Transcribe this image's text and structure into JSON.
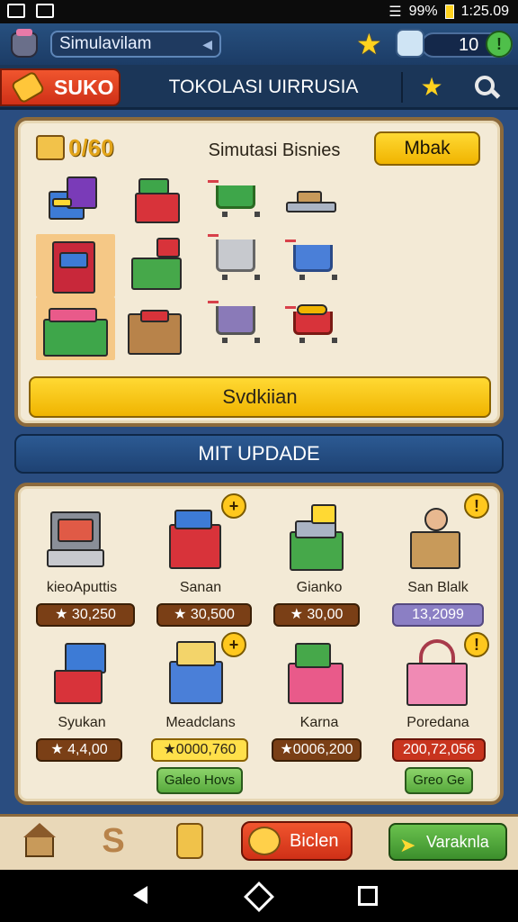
{
  "status_bar": {
    "battery": "99%",
    "time": "1:25.09"
  },
  "top_bar": {
    "username": "Simulavilam",
    "resource_count": "10",
    "plus_label": "!"
  },
  "nav": {
    "suko_label": "SUKO",
    "title": "TOKOLASI UIRRUSIA"
  },
  "shop_panel": {
    "coins": "0/60",
    "title": "Simutasi Bisnies",
    "mbak_label": "Mbak",
    "items": [
      "register-box",
      "grocery-box",
      "green-cart",
      "flat-cart",
      "red-shelf",
      "green-crate",
      "silver-cart",
      "blue-cart",
      "produce-basket",
      "wooden-crate",
      "purple-cart",
      "fruit-cart"
    ],
    "selected_index": 4,
    "action_label": "Svdkiian"
  },
  "update_header": "MIT UPDADE",
  "update_items": [
    {
      "name": "kieoAputtis",
      "price": "30,250",
      "price_style": "brown"
    },
    {
      "name": "Sanan",
      "price": "30,500",
      "price_style": "brown",
      "badge": "+"
    },
    {
      "name": "Gianko",
      "price": "30,00",
      "price_style": "brown"
    },
    {
      "name": "San Blalk",
      "price": "13,2099",
      "price_style": "purple",
      "badge": "!"
    },
    {
      "name": "Syukan",
      "price": "4,4,00",
      "price_style": "brown"
    },
    {
      "name": "Meadclans",
      "price": "0000,760",
      "price_style": "yellow",
      "badge": "+",
      "action": "Galeo Hovs"
    },
    {
      "name": "Karna",
      "price": "0006,200",
      "price_style": "brown"
    },
    {
      "name": "Poredana",
      "price": "200,72,056",
      "price_style": "red",
      "badge": "!",
      "action": "Greo Ge"
    }
  ],
  "footer": {
    "bicien_label": "Biclen",
    "vara_label": "Varaknla"
  },
  "icons": {
    "home": "home-icon",
    "swap": "swap-icon",
    "scroll": "scroll-icon",
    "star": "star-icon",
    "search": "search-icon"
  }
}
